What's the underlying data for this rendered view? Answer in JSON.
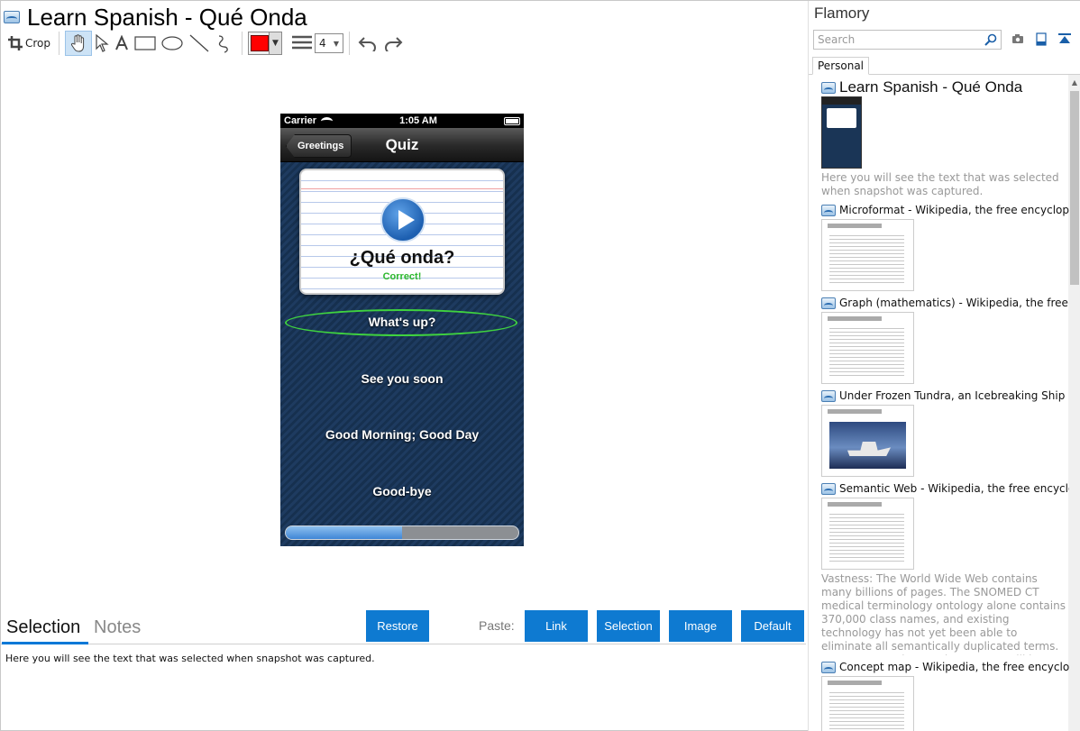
{
  "window": {
    "title": "Learn Spanish - Qué Onda"
  },
  "toolbar": {
    "crop_label": "Crop",
    "color": "#ff0000",
    "line_width": "4"
  },
  "phone": {
    "status": {
      "carrier": "Carrier",
      "time": "1:05 AM"
    },
    "nav": {
      "back_label": "Greetings",
      "title": "Quiz"
    },
    "card": {
      "phrase": "¿Qué onda?",
      "result": "Correct!"
    },
    "answers": [
      "What's up?",
      "See you soon",
      "Good Morning; Good Day",
      "Good-bye"
    ],
    "progress": 0.5
  },
  "bottom": {
    "tab_selection": "Selection",
    "tab_notes": "Notes",
    "restore_label": "Restore",
    "paste_label": "Paste:",
    "link_label": "Link",
    "selection_label": "Selection",
    "image_label": "Image",
    "default_label": "Default",
    "selection_text": "Here you will see the text that was selected when snapshot was captured."
  },
  "panel": {
    "title": "Flamory",
    "search_placeholder": "Search",
    "tab_personal": "Personal",
    "entries": [
      {
        "title": "Learn Spanish - Qué Onda",
        "desc": "Here you will see the text that was selected when snapshot was captured."
      },
      {
        "title": "Microformat - Wikipedia, the free encyclopedia"
      },
      {
        "title": "Graph (mathematics) - Wikipedia, the free encyclopedia"
      },
      {
        "title": "Under Frozen Tundra, an Icebreaking Ship Uncovers"
      },
      {
        "title": "Semantic Web - Wikipedia, the free encyclopedia",
        "desc": "Vastness: The World Wide Web contains many billions of pages. The SNOMED CT medical terminology ontology alone contains 370,000 class names, and existing technology has not yet been able to eliminate all semantically duplicated terms. Any automated reasoning system will have to deal with truly huge inputs."
      },
      {
        "title": "Concept map - Wikipedia, the free encyclopedia"
      }
    ]
  },
  "colors": {
    "accent_blue": "#0e7ad1",
    "selection_underline": "#0078d7",
    "correct_green": "#2db82d"
  }
}
